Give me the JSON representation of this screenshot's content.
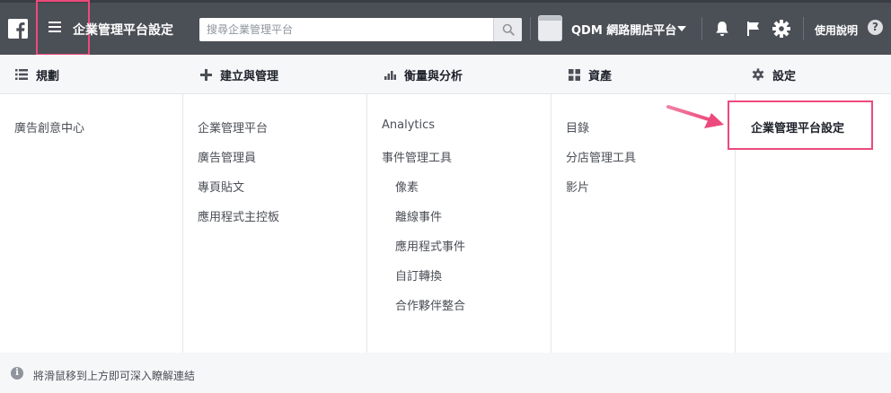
{
  "topbar": {
    "page_title": "企業管理平台設定",
    "search": {
      "placeholder": "搜尋企業管理平台",
      "value": ""
    },
    "account": {
      "name": "QDM 網路開店平台"
    },
    "help_label": "使用說明",
    "help_icon_glyph": "?",
    "icons": {
      "logo": "facebook-logo",
      "menu": "hamburger-icon",
      "search": "search-icon",
      "notifications": "bell-icon",
      "flag": "flag-icon",
      "settings": "gear-icon",
      "help": "question-icon"
    }
  },
  "columns": [
    {
      "heading": "規劃",
      "icon": "list-icon",
      "items": [
        {
          "label": "廣告創意中心"
        }
      ]
    },
    {
      "heading": "建立與管理",
      "icon": "plus-icon",
      "items": [
        {
          "label": "企業管理平台"
        },
        {
          "label": "廣告管理員"
        },
        {
          "label": "專頁貼文"
        },
        {
          "label": "應用程式主控板"
        }
      ]
    },
    {
      "heading": "衡量與分析",
      "icon": "bar-chart-icon",
      "items": [
        {
          "label": "Analytics"
        },
        {
          "label": "事件管理工具"
        },
        {
          "label": "像素"
        },
        {
          "label": "離線事件"
        },
        {
          "label": "應用程式事件"
        },
        {
          "label": "自訂轉換"
        },
        {
          "label": "合作夥伴整合"
        }
      ]
    },
    {
      "heading": "資產",
      "icon": "grid-icon",
      "items": [
        {
          "label": "目錄"
        },
        {
          "label": "分店管理工具"
        },
        {
          "label": "影片"
        }
      ]
    },
    {
      "heading": "設定",
      "icon": "gear-icon",
      "items": [
        {
          "label": "企業管理平台設定"
        }
      ]
    }
  ],
  "footer": {
    "hint": "將滑鼠移到上方即可深入瞭解連結",
    "info_icon_glyph": "i"
  },
  "colors": {
    "topbar_bg": "#4b4f56",
    "highlight": "#ec4a7c",
    "header_row_bg": "#f6f7f9",
    "text_primary": "#1d2129",
    "text_secondary": "#4b4f56"
  }
}
